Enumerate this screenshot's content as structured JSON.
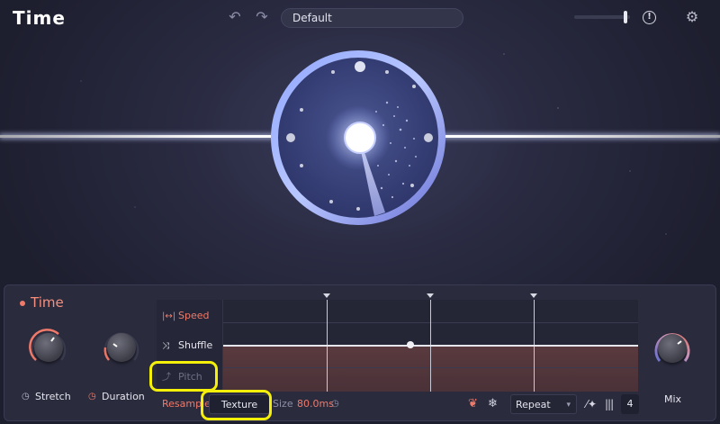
{
  "header": {
    "title": "Time",
    "undo_icon": "undo-icon",
    "redo_icon": "redo-icon",
    "preset_name": "Default",
    "output_level": 0.95,
    "alert_icon": "alert-icon",
    "alert_glyph": "!",
    "settings_icon": "gear-icon"
  },
  "module": {
    "title": "Time",
    "knobs": {
      "stretch": {
        "label": "Stretch",
        "icon": "clock-icon"
      },
      "duration": {
        "label": "Duration",
        "icon": "clock-icon"
      },
      "mix": {
        "label": "Mix"
      }
    },
    "modes": [
      {
        "label": "Speed",
        "icon": "speed-icon",
        "glyph": "|↔|",
        "active": true
      },
      {
        "label": "Shuffle",
        "icon": "shuffle-icon",
        "glyph": "⤨",
        "active": false
      },
      {
        "label": "Pitch",
        "icon": "pitch-icon",
        "glyph": "⤴",
        "active": false
      }
    ]
  },
  "toolbar": {
    "resample_label": "Resample",
    "texture_label": "Texture",
    "size_label": "Size",
    "size_value": "80.0ms",
    "repeat_label": "Repeat",
    "repeat_chevron": "▾",
    "count_value": "4"
  },
  "colors": {
    "accent": "#f07a6a",
    "background": "#1d1e2e",
    "panel": "#2a2b3d",
    "highlight": "#f5f00a"
  }
}
